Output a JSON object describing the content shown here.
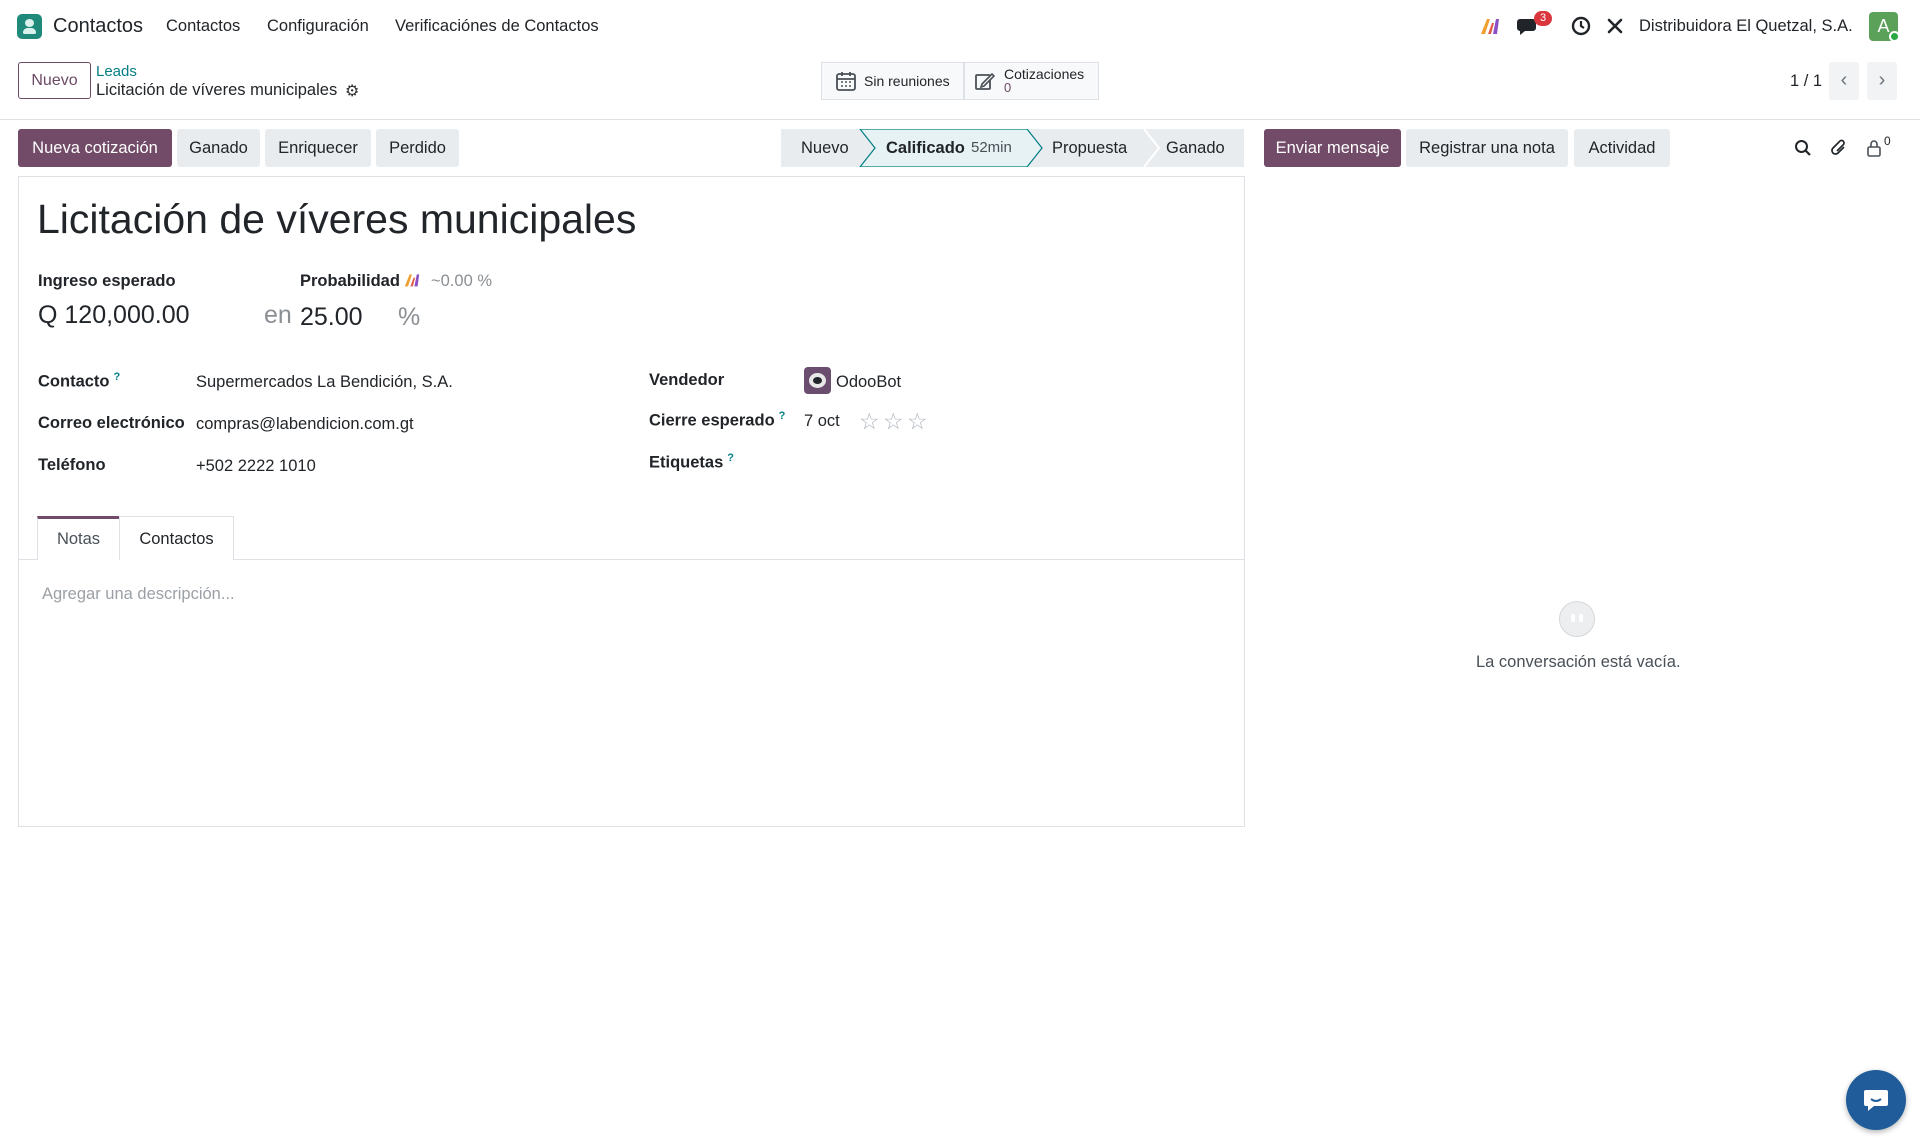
{
  "navbar": {
    "app_name": "Contactos",
    "menu": [
      "Contactos",
      "Configuración",
      "Verificaciónes de Contactos"
    ],
    "messages_badge": "3",
    "company": "Distribuidora El Quetzal, S.A.",
    "avatar_letter": "A"
  },
  "control_panel": {
    "new_button": "Nuevo",
    "breadcrumb_parent": "Leads",
    "breadcrumb_current": "Licitación de víveres municipales",
    "smart_meetings": "Sin reuniones",
    "smart_quotes_label": "Cotizaciones",
    "smart_quotes_count": "0",
    "pager": "1 / 1"
  },
  "actions": {
    "new_quote": "Nueva cotización",
    "won": "Ganado",
    "enrich": "Enriquecer",
    "lost": "Perdido"
  },
  "stages": {
    "items": [
      "Nuevo",
      "Calificado",
      "Propuesta",
      "Ganado"
    ],
    "active": "Calificado",
    "active_duration": "52min"
  },
  "chatter": {
    "send_message": "Enviar mensaje",
    "log_note": "Registrar una nota",
    "activity": "Actividad",
    "followers_count": "0",
    "empty_text": "La conversación está vacía."
  },
  "form": {
    "title": "Licitación de víveres municipales",
    "expected_revenue_label": "Ingreso esperado",
    "expected_revenue_value": "Q 120,000.00",
    "at_word": "en",
    "probability_label": "Probabilidad",
    "ai_probability": "~0.00 %",
    "probability_value": "25.00",
    "percent_sign": "%",
    "contact_label": "Contacto",
    "contact_value": "Supermercados La Bendición, S.A.",
    "email_label": "Correo electrónico",
    "email_value": "compras@labendicion.com.gt",
    "phone_label": "Teléfono",
    "phone_value": "+502 2222 1010",
    "salesperson_label": "Vendedor",
    "salesperson_value": "OdooBot",
    "expected_close_label": "Cierre esperado",
    "expected_close_value": "7 oct",
    "priority_stars": 0,
    "tags_label": "Etiquetas",
    "help_mark": "?",
    "tabs": [
      "Notas",
      "Contactos"
    ],
    "description_placeholder": "Agregar una descripción..."
  },
  "colors": {
    "brand": "#714b67",
    "link": "#017e84",
    "badge": "#d9363e"
  }
}
